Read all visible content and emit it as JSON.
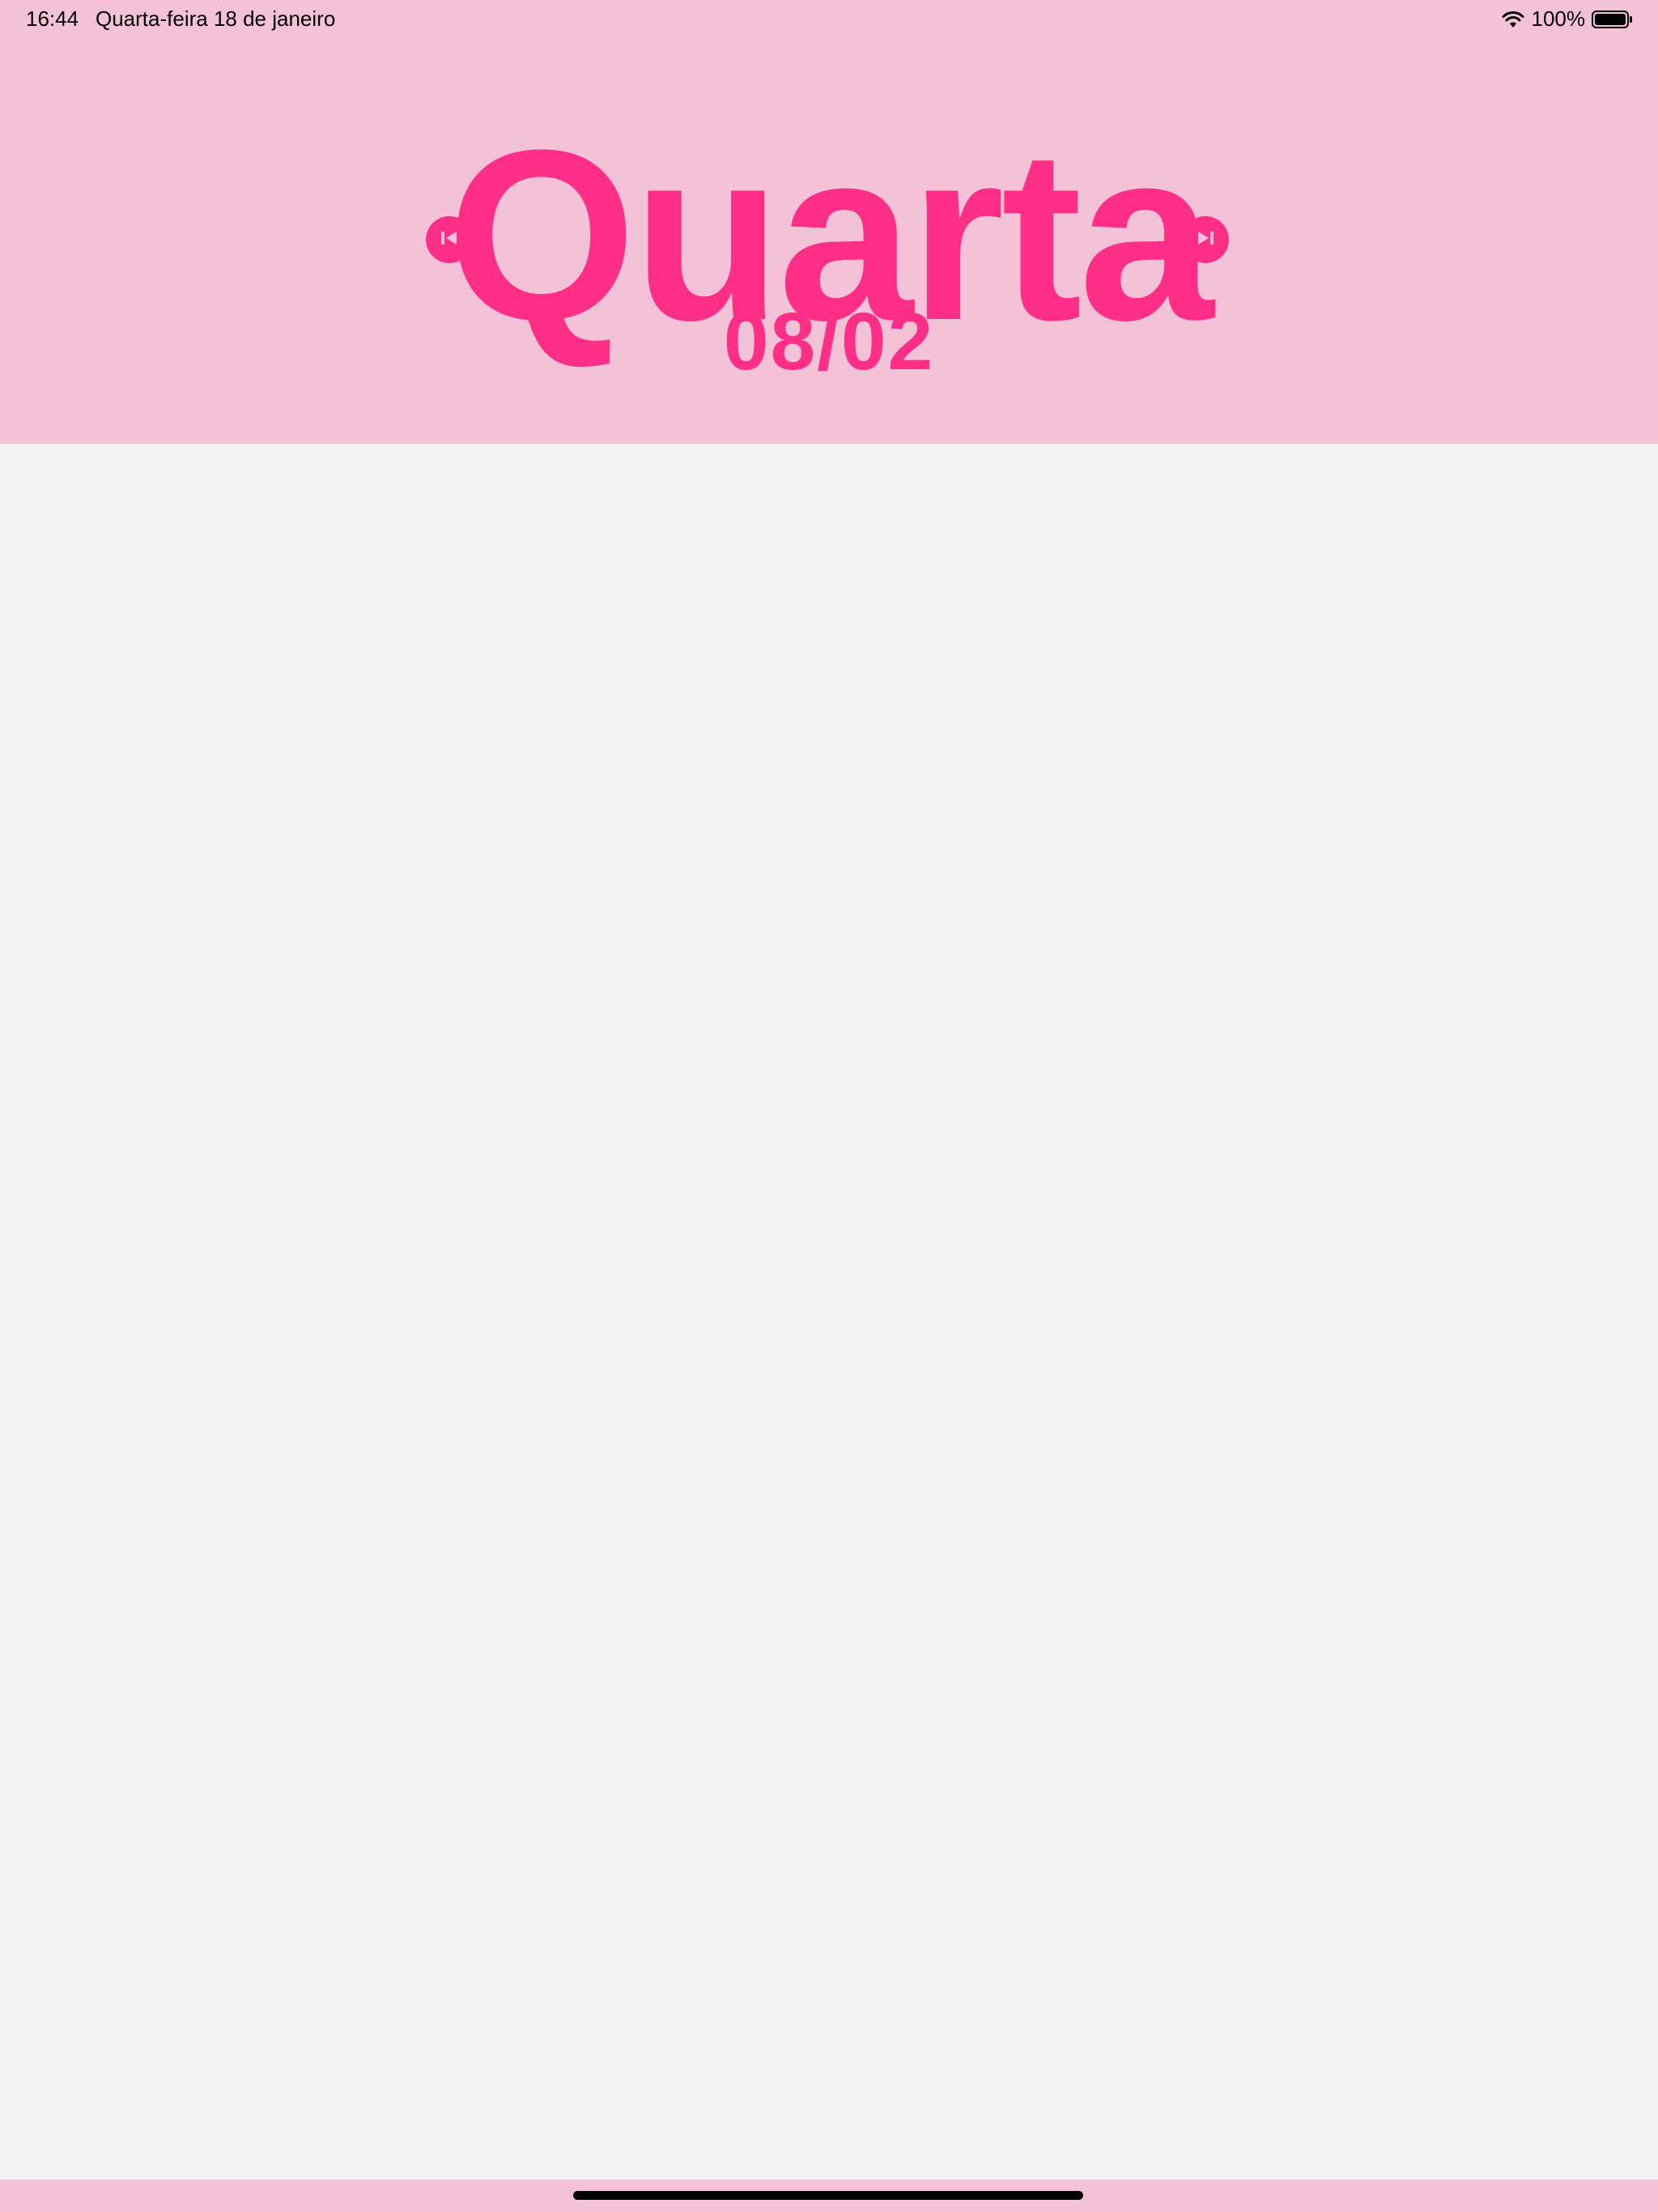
{
  "status_bar": {
    "time": "16:44",
    "date": "Quarta-feira 18 de janeiro",
    "battery": "100%",
    "wifi_icon": "wifi-icon",
    "battery_icon": "battery-icon"
  },
  "header": {
    "day": "Quarta",
    "date": "08/02",
    "prev_icon": "skip-back-icon",
    "next_icon": "skip-forward-icon"
  },
  "colors": {
    "accent": "#ff2f88",
    "header_bg": "#f4c2d6",
    "content_bg": "#f2f2f2"
  }
}
